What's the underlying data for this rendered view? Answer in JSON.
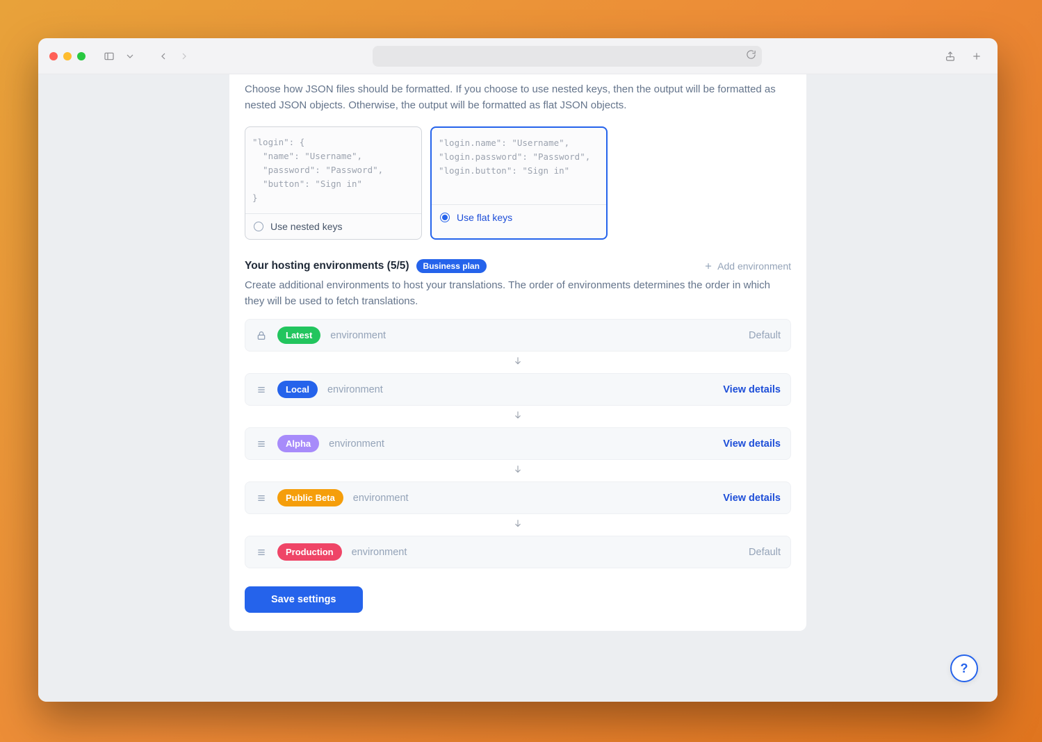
{
  "json_format": {
    "description": "Choose how JSON files should be formatted. If you choose to use nested keys, then the output will be formatted as nested JSON objects. Otherwise, the output will be formatted as flat JSON objects.",
    "nested": {
      "label": "Use nested keys",
      "code": "\"login\": {\n  \"name\": \"Username\",\n  \"password\": \"Password\",\n  \"button\": \"Sign in\"\n}"
    },
    "flat": {
      "label": "Use flat keys",
      "code": "\"login.name\": \"Username\",\n\"login.password\": \"Password\",\n\"login.button\": \"Sign in\""
    },
    "selected": "flat"
  },
  "hosting": {
    "title": "Your hosting environments (5/5)",
    "plan_badge": "Business plan",
    "add_label": "Add environment",
    "description": "Create additional environments to host your translations. The order of environments determines the order in which they will be used to fetch translations.",
    "env_word": "environment",
    "default_word": "Default",
    "view_details": "View details",
    "items": [
      {
        "name": "Latest",
        "color": "green",
        "locked": true,
        "action": "default"
      },
      {
        "name": "Local",
        "color": "blue",
        "locked": false,
        "action": "details"
      },
      {
        "name": "Alpha",
        "color": "purple",
        "locked": false,
        "action": "details"
      },
      {
        "name": "Public Beta",
        "color": "orange",
        "locked": false,
        "action": "details"
      },
      {
        "name": "Production",
        "color": "red",
        "locked": false,
        "action": "default"
      }
    ]
  },
  "save_button": "Save settings",
  "help_label": "?"
}
